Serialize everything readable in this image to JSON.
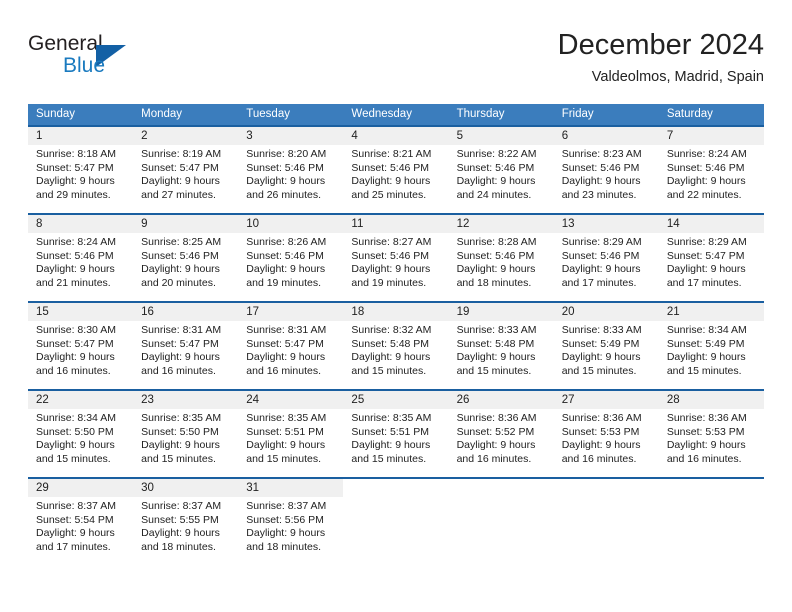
{
  "brand": {
    "word_one": "General",
    "word_two": "Blue",
    "triangle_color": "#1360a5",
    "blue_text_color": "#1a7abf"
  },
  "header": {
    "month_title": "December 2024",
    "location": "Valdeolmos, Madrid, Spain"
  },
  "theme": {
    "header_blue": "#3b7dbd",
    "row_border_blue": "#1a5fa0",
    "date_band_gray": "#f0f0f0",
    "text_color": "#222222"
  },
  "weekdays": [
    "Sunday",
    "Monday",
    "Tuesday",
    "Wednesday",
    "Thursday",
    "Friday",
    "Saturday"
  ],
  "weeks": [
    [
      {
        "day": "1",
        "lines": [
          "Sunrise: 8:18 AM",
          "Sunset: 5:47 PM",
          "Daylight: 9 hours",
          "and 29 minutes."
        ]
      },
      {
        "day": "2",
        "lines": [
          "Sunrise: 8:19 AM",
          "Sunset: 5:47 PM",
          "Daylight: 9 hours",
          "and 27 minutes."
        ]
      },
      {
        "day": "3",
        "lines": [
          "Sunrise: 8:20 AM",
          "Sunset: 5:46 PM",
          "Daylight: 9 hours",
          "and 26 minutes."
        ]
      },
      {
        "day": "4",
        "lines": [
          "Sunrise: 8:21 AM",
          "Sunset: 5:46 PM",
          "Daylight: 9 hours",
          "and 25 minutes."
        ]
      },
      {
        "day": "5",
        "lines": [
          "Sunrise: 8:22 AM",
          "Sunset: 5:46 PM",
          "Daylight: 9 hours",
          "and 24 minutes."
        ]
      },
      {
        "day": "6",
        "lines": [
          "Sunrise: 8:23 AM",
          "Sunset: 5:46 PM",
          "Daylight: 9 hours",
          "and 23 minutes."
        ]
      },
      {
        "day": "7",
        "lines": [
          "Sunrise: 8:24 AM",
          "Sunset: 5:46 PM",
          "Daylight: 9 hours",
          "and 22 minutes."
        ]
      }
    ],
    [
      {
        "day": "8",
        "lines": [
          "Sunrise: 8:24 AM",
          "Sunset: 5:46 PM",
          "Daylight: 9 hours",
          "and 21 minutes."
        ]
      },
      {
        "day": "9",
        "lines": [
          "Sunrise: 8:25 AM",
          "Sunset: 5:46 PM",
          "Daylight: 9 hours",
          "and 20 minutes."
        ]
      },
      {
        "day": "10",
        "lines": [
          "Sunrise: 8:26 AM",
          "Sunset: 5:46 PM",
          "Daylight: 9 hours",
          "and 19 minutes."
        ]
      },
      {
        "day": "11",
        "lines": [
          "Sunrise: 8:27 AM",
          "Sunset: 5:46 PM",
          "Daylight: 9 hours",
          "and 19 minutes."
        ]
      },
      {
        "day": "12",
        "lines": [
          "Sunrise: 8:28 AM",
          "Sunset: 5:46 PM",
          "Daylight: 9 hours",
          "and 18 minutes."
        ]
      },
      {
        "day": "13",
        "lines": [
          "Sunrise: 8:29 AM",
          "Sunset: 5:46 PM",
          "Daylight: 9 hours",
          "and 17 minutes."
        ]
      },
      {
        "day": "14",
        "lines": [
          "Sunrise: 8:29 AM",
          "Sunset: 5:47 PM",
          "Daylight: 9 hours",
          "and 17 minutes."
        ]
      }
    ],
    [
      {
        "day": "15",
        "lines": [
          "Sunrise: 8:30 AM",
          "Sunset: 5:47 PM",
          "Daylight: 9 hours",
          "and 16 minutes."
        ]
      },
      {
        "day": "16",
        "lines": [
          "Sunrise: 8:31 AM",
          "Sunset: 5:47 PM",
          "Daylight: 9 hours",
          "and 16 minutes."
        ]
      },
      {
        "day": "17",
        "lines": [
          "Sunrise: 8:31 AM",
          "Sunset: 5:47 PM",
          "Daylight: 9 hours",
          "and 16 minutes."
        ]
      },
      {
        "day": "18",
        "lines": [
          "Sunrise: 8:32 AM",
          "Sunset: 5:48 PM",
          "Daylight: 9 hours",
          "and 15 minutes."
        ]
      },
      {
        "day": "19",
        "lines": [
          "Sunrise: 8:33 AM",
          "Sunset: 5:48 PM",
          "Daylight: 9 hours",
          "and 15 minutes."
        ]
      },
      {
        "day": "20",
        "lines": [
          "Sunrise: 8:33 AM",
          "Sunset: 5:49 PM",
          "Daylight: 9 hours",
          "and 15 minutes."
        ]
      },
      {
        "day": "21",
        "lines": [
          "Sunrise: 8:34 AM",
          "Sunset: 5:49 PM",
          "Daylight: 9 hours",
          "and 15 minutes."
        ]
      }
    ],
    [
      {
        "day": "22",
        "lines": [
          "Sunrise: 8:34 AM",
          "Sunset: 5:50 PM",
          "Daylight: 9 hours",
          "and 15 minutes."
        ]
      },
      {
        "day": "23",
        "lines": [
          "Sunrise: 8:35 AM",
          "Sunset: 5:50 PM",
          "Daylight: 9 hours",
          "and 15 minutes."
        ]
      },
      {
        "day": "24",
        "lines": [
          "Sunrise: 8:35 AM",
          "Sunset: 5:51 PM",
          "Daylight: 9 hours",
          "and 15 minutes."
        ]
      },
      {
        "day": "25",
        "lines": [
          "Sunrise: 8:35 AM",
          "Sunset: 5:51 PM",
          "Daylight: 9 hours",
          "and 15 minutes."
        ]
      },
      {
        "day": "26",
        "lines": [
          "Sunrise: 8:36 AM",
          "Sunset: 5:52 PM",
          "Daylight: 9 hours",
          "and 16 minutes."
        ]
      },
      {
        "day": "27",
        "lines": [
          "Sunrise: 8:36 AM",
          "Sunset: 5:53 PM",
          "Daylight: 9 hours",
          "and 16 minutes."
        ]
      },
      {
        "day": "28",
        "lines": [
          "Sunrise: 8:36 AM",
          "Sunset: 5:53 PM",
          "Daylight: 9 hours",
          "and 16 minutes."
        ]
      }
    ],
    [
      {
        "day": "29",
        "lines": [
          "Sunrise: 8:37 AM",
          "Sunset: 5:54 PM",
          "Daylight: 9 hours",
          "and 17 minutes."
        ]
      },
      {
        "day": "30",
        "lines": [
          "Sunrise: 8:37 AM",
          "Sunset: 5:55 PM",
          "Daylight: 9 hours",
          "and 18 minutes."
        ]
      },
      {
        "day": "31",
        "lines": [
          "Sunrise: 8:37 AM",
          "Sunset: 5:56 PM",
          "Daylight: 9 hours",
          "and 18 minutes."
        ]
      },
      {
        "day": "",
        "lines": []
      },
      {
        "day": "",
        "lines": []
      },
      {
        "day": "",
        "lines": []
      },
      {
        "day": "",
        "lines": []
      }
    ]
  ]
}
